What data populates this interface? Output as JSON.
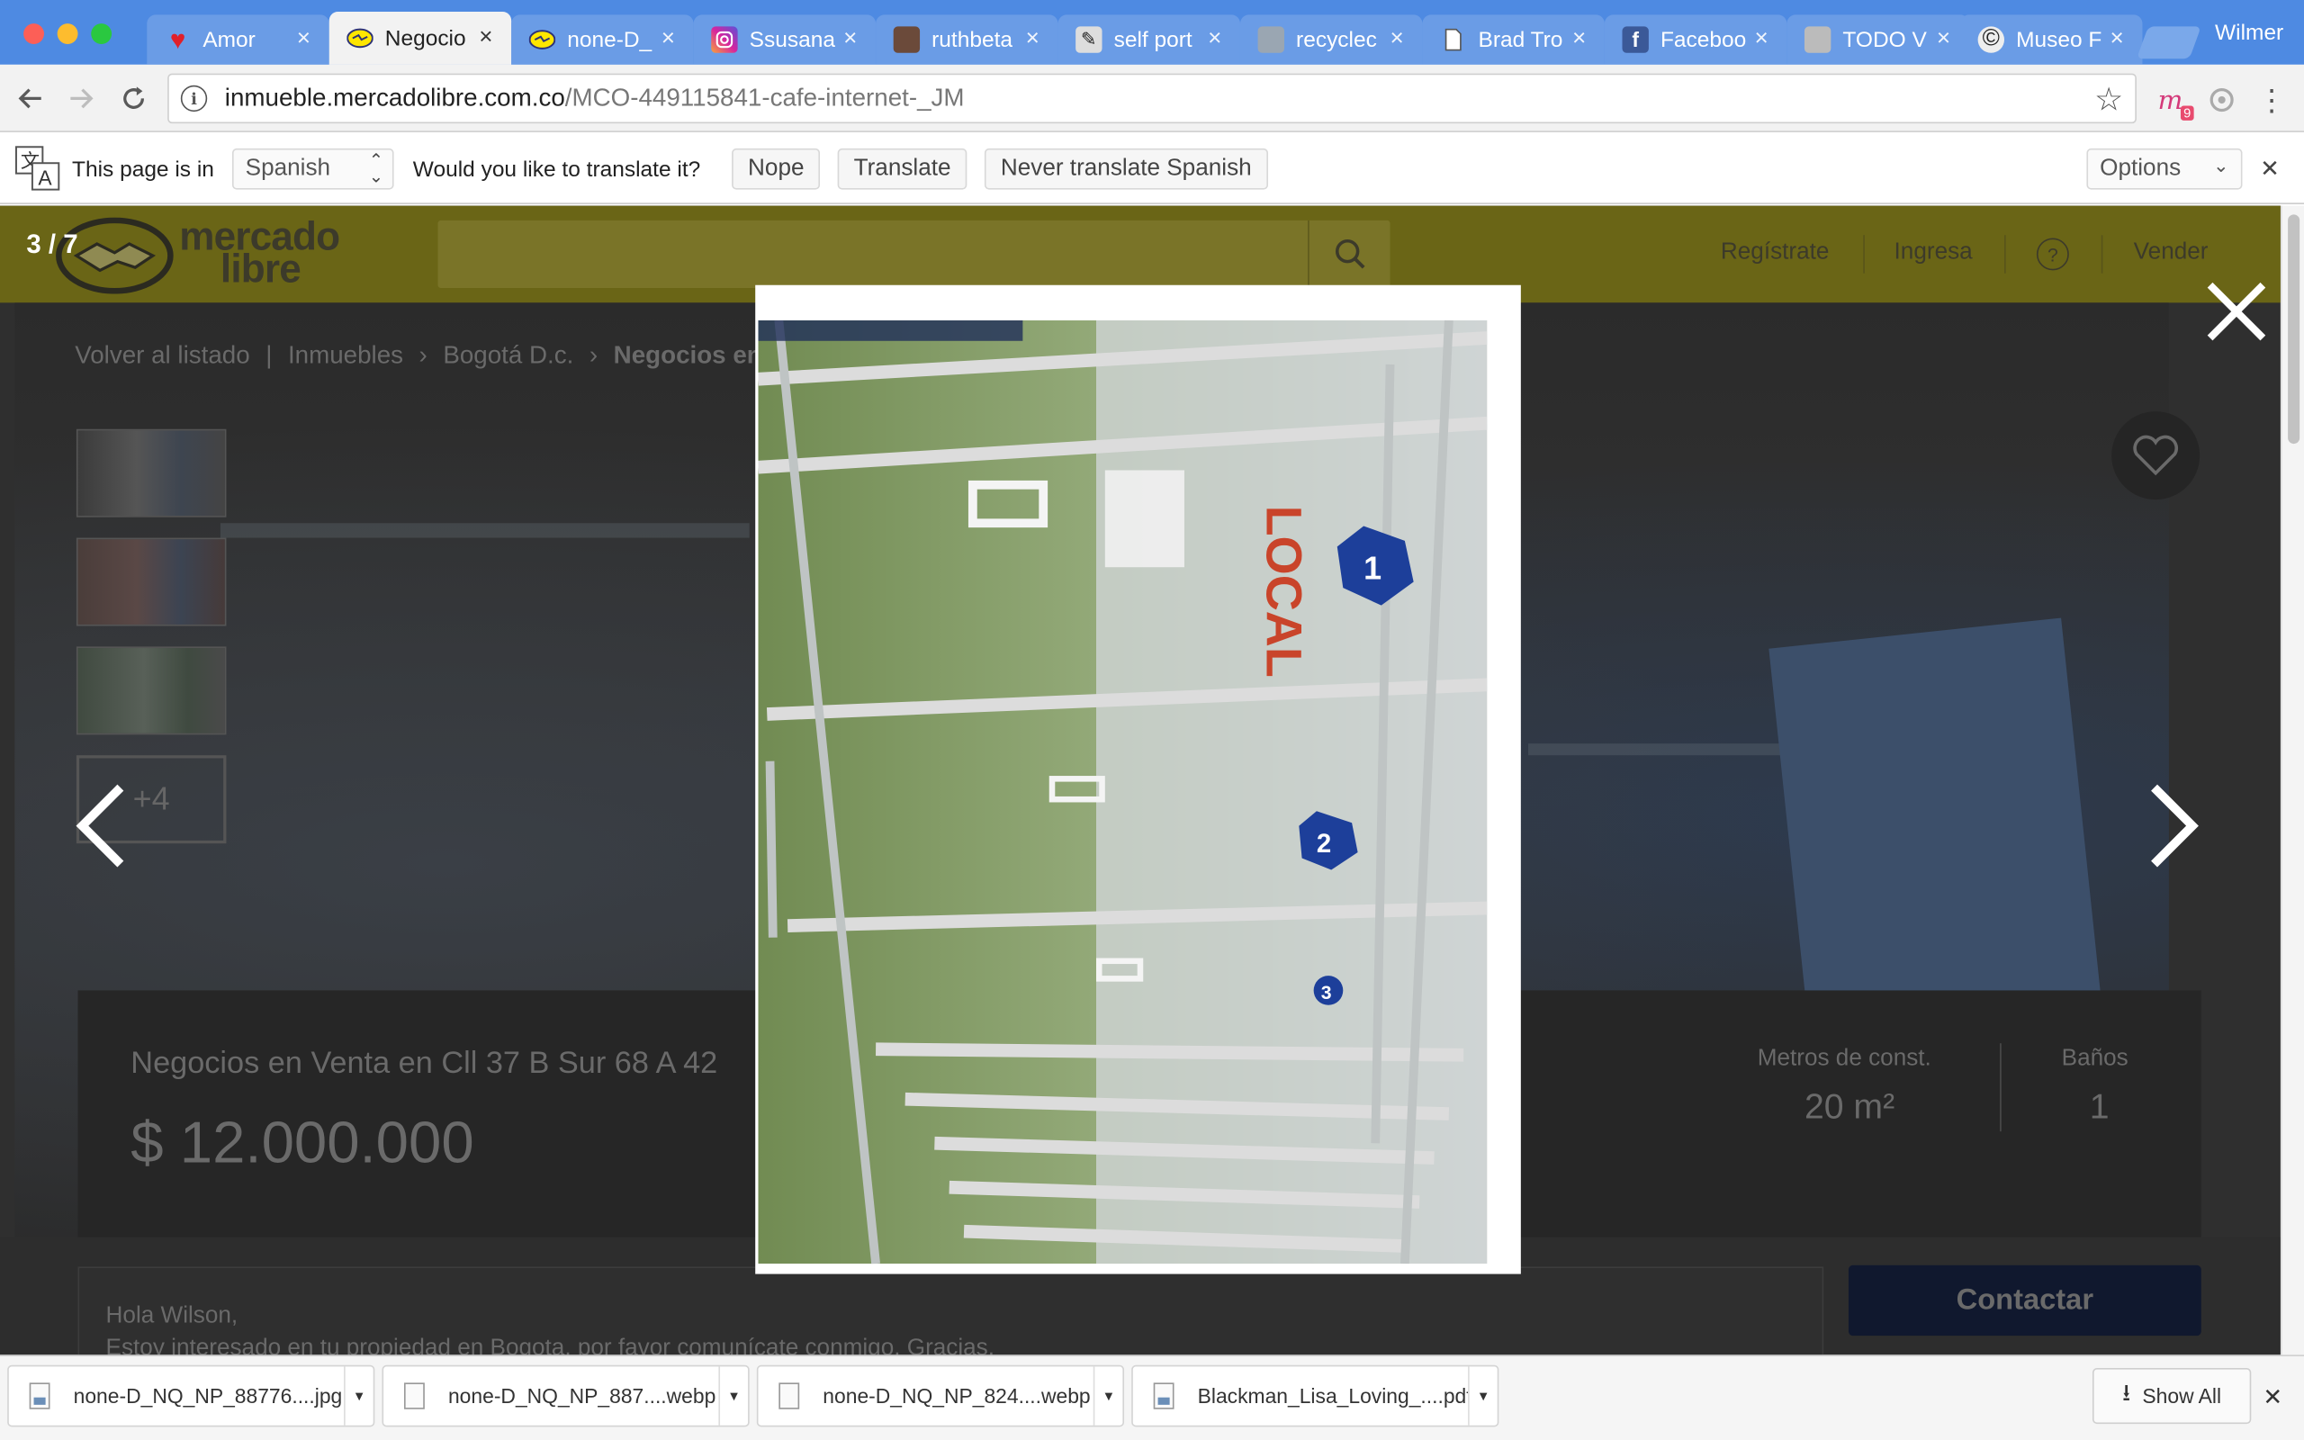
{
  "browser": {
    "profile_name": "Wilmer",
    "tabs": [
      {
        "label": "Amor",
        "favicon": "heart-icon",
        "active": false
      },
      {
        "label": "Negocio",
        "favicon": "mercadolibre-icon",
        "active": true
      },
      {
        "label": "none-D_",
        "favicon": "mercadolibre-icon",
        "active": false
      },
      {
        "label": "Ssusana",
        "favicon": "instagram-icon",
        "active": false
      },
      {
        "label": "ruthbeta",
        "favicon": "photo-icon",
        "active": false
      },
      {
        "label": "self port",
        "favicon": "photo-icon",
        "active": false
      },
      {
        "label": "recyclec",
        "favicon": "photo-icon",
        "active": false
      },
      {
        "label": "Brad Tro",
        "favicon": "document-icon",
        "active": false
      },
      {
        "label": "Faceboo",
        "favicon": "facebook-icon",
        "active": false
      },
      {
        "label": "TODO V",
        "favicon": "photo-icon",
        "active": false
      },
      {
        "label": "Museo F",
        "favicon": "copyright-icon",
        "active": false
      }
    ],
    "url_host": "inmueble.mercadolibre.com.co",
    "url_path": "/MCO-449115841-cafe-internet-_JM",
    "extension_badge": "9"
  },
  "translate_bar": {
    "page_is_in": "This page is in",
    "language": "Spanish",
    "question": "Would you like to translate it?",
    "nope": "Nope",
    "translate": "Translate",
    "never": "Never translate Spanish",
    "options": "Options"
  },
  "site": {
    "logo_line1": "mercado",
    "logo_line2": "libre",
    "nav_register": "Regístrate",
    "nav_login": "Ingresa",
    "nav_help": "?",
    "nav_sell": "Vender",
    "breadcrumb": {
      "back": "Volver al listado",
      "sep": "|",
      "crumb1": "Inmuebles",
      "crumb2": "Bogotá D.c.",
      "current": "Negocios en V"
    },
    "more_photos": "+4",
    "listing_title": "Negocios en Venta en Cll 37 B Sur 68 A 42",
    "price": "$ 12.000.000",
    "attr1_label": "Metros de const.",
    "attr1_value": "20 m²",
    "attr2_label": "Baños",
    "attr2_value": "1",
    "message_line1": "Hola Wilson,",
    "message_line2": "Estoy interesado en tu propiedad en Bogota, por favor comunícate conmigo. Gracias.",
    "contact_button": "Contactar"
  },
  "lightbox": {
    "counter": "3 / 7",
    "photo_text_local": "LOCAL",
    "booth_numbers": [
      "1",
      "2",
      "3"
    ]
  },
  "downloads": {
    "items": [
      {
        "name": "none-D_NQ_NP_88776....jpg",
        "type": "image"
      },
      {
        "name": "none-D_NQ_NP_887....webp",
        "type": "file"
      },
      {
        "name": "none-D_NQ_NP_824....webp",
        "type": "file"
      },
      {
        "name": "Blackman_Lisa_Loving_....pdf",
        "type": "image"
      }
    ],
    "show_all": "Show All"
  }
}
